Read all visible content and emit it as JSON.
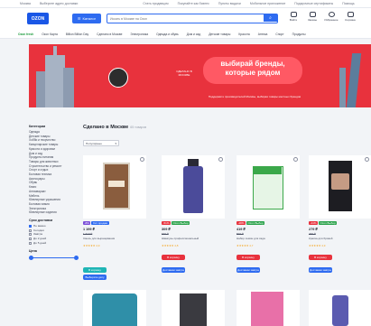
{
  "topbar": {
    "items": [
      "Москва",
      "Выберите адрес доставки",
      "Стать продавцом",
      "Покупайте как бизнес",
      "Пункты выдачи",
      "Мобильное приложение",
      "Подарочные сертификаты",
      "Помощь"
    ]
  },
  "header": {
    "logo": "OZON",
    "catalog_label": "Каталог",
    "search_placeholder": "Искать в Москве на Ozon",
    "icons": [
      {
        "label": "Войти",
        "icon": "user-icon"
      },
      {
        "label": "Заказы",
        "icon": "box-icon"
      },
      {
        "label": "Избранное",
        "icon": "heart-icon"
      },
      {
        "label": "Корзина",
        "icon": "cart-icon"
      }
    ]
  },
  "nav": [
    "Ozon fresh",
    "Ozon Карта",
    "Billion Billion Day",
    "Сделано в Москве",
    "Электроника",
    "Одежда и обувь",
    "Дом и сад",
    "Детские товары",
    "Красота",
    "Аптека",
    "Спорт",
    "Продукты"
  ],
  "banner": {
    "headline": "выбирай бренды, которые рядом",
    "badge": "СДЕЛАНО В МОСКВЕ",
    "subtitle": "Поддержите производителей Москвы, выбирая товары местных брендов"
  },
  "sidebar": {
    "heading": "Категории",
    "categories": [
      "Одежда",
      "Детские товары",
      "Хобби и творчество",
      "Канцелярские товары",
      "Красота и здоровье",
      "Дом и сад",
      "Продукты питания",
      "Товары для животных",
      "Строительство и ремонт",
      "Спорт и отдых",
      "Бытовая техника",
      "Аксессуары",
      "Обувь",
      "Книги",
      "Антиквариат",
      "Мебель",
      "Ювелирные украшения",
      "Бытовая химия",
      "Электроника",
      "Ювелирные изделия"
    ],
    "delivery_heading": "Срок доставки",
    "delivery_options": [
      {
        "label": "Не важно",
        "checked": true
      },
      {
        "label": "Сегодня",
        "checked": false
      },
      {
        "label": "Завтра",
        "checked": false
      },
      {
        "label": "До 2 дней",
        "checked": false
      },
      {
        "label": "До 5 дней",
        "checked": false
      }
    ],
    "price_heading": "Цена"
  },
  "main": {
    "title": "Сделано в Москве",
    "count": "65 товаров",
    "sort_label": "Популярные"
  },
  "products": [
    {
      "badge1": "-8%",
      "badge2": "Хит продаж",
      "price": "1 199 ₽",
      "old": "1 310 ₽",
      "name": "Смесь для выращивания",
      "rating": "★★★★★ 4,9",
      "btn1": "В корзину",
      "btn2": "Выберите дату"
    },
    {
      "badge1": "-51%",
      "badge2": "Ozon Выбор",
      "price": "309 ₽",
      "old": "630 ₽",
      "name": "Шампунь профессиональный",
      "rating": "★★★★★ 4,8",
      "btn1": "В корзину",
      "btn2": "Доставим завтра"
    },
    {
      "badge1": "-28%",
      "badge2": "Ozon Выбор",
      "price": "419 ₽",
      "old": "590 ₽",
      "name": "Набор семян для сада",
      "rating": "★★★★★ 4,7",
      "btn1": "В корзину",
      "btn2": "Доставим завтра"
    },
    {
      "badge1": "-44%",
      "badge2": "Ozon Выбор",
      "price": "279 ₽",
      "old": "499 ₽",
      "name": "Краска для бровей",
      "rating": "★★★★★ 4,9",
      "btn1": "В корзину",
      "btn2": "Доставим завтра"
    }
  ]
}
